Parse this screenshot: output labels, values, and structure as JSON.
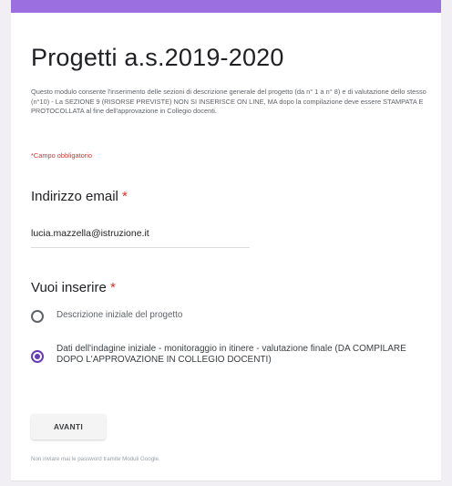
{
  "form": {
    "accent_color": "#9b6fe0",
    "title": "Progetti a.s.2019-2020",
    "description": "Questo modulo consente l'inserimento delle sezioni di descrizione generale del progetto (da n° 1 a n° 8) e di valutazione dello stesso (n°10) - La SEZIONE 9 (RISORSE PREVISTE) NON SI INSERISCE ON LINE, MA dopo la compilazione deve essere STAMPATA E PROTOCOLLATA al fine dell'approvazione in Collegio docenti.",
    "required_note": "*Campo obbligatorio"
  },
  "email": {
    "label": "Indirizzo email",
    "required_mark": "*",
    "value": "lucia.mazzella@istruzione.it"
  },
  "choice": {
    "label": "Vuoi inserire",
    "required_mark": "*",
    "selected_index": 1,
    "options": [
      "Descrizione iniziale del progetto",
      "Dati dell'indagine iniziale - monitoraggio in itinere - valutazione finale (DA COMPILARE DOPO L'APPROVAZIONE IN COLLEGIO DOCENTI)"
    ]
  },
  "submit": {
    "label": "AVANTI"
  },
  "footer": {
    "note": "Non inviare mai le password tramite Moduli Google."
  }
}
